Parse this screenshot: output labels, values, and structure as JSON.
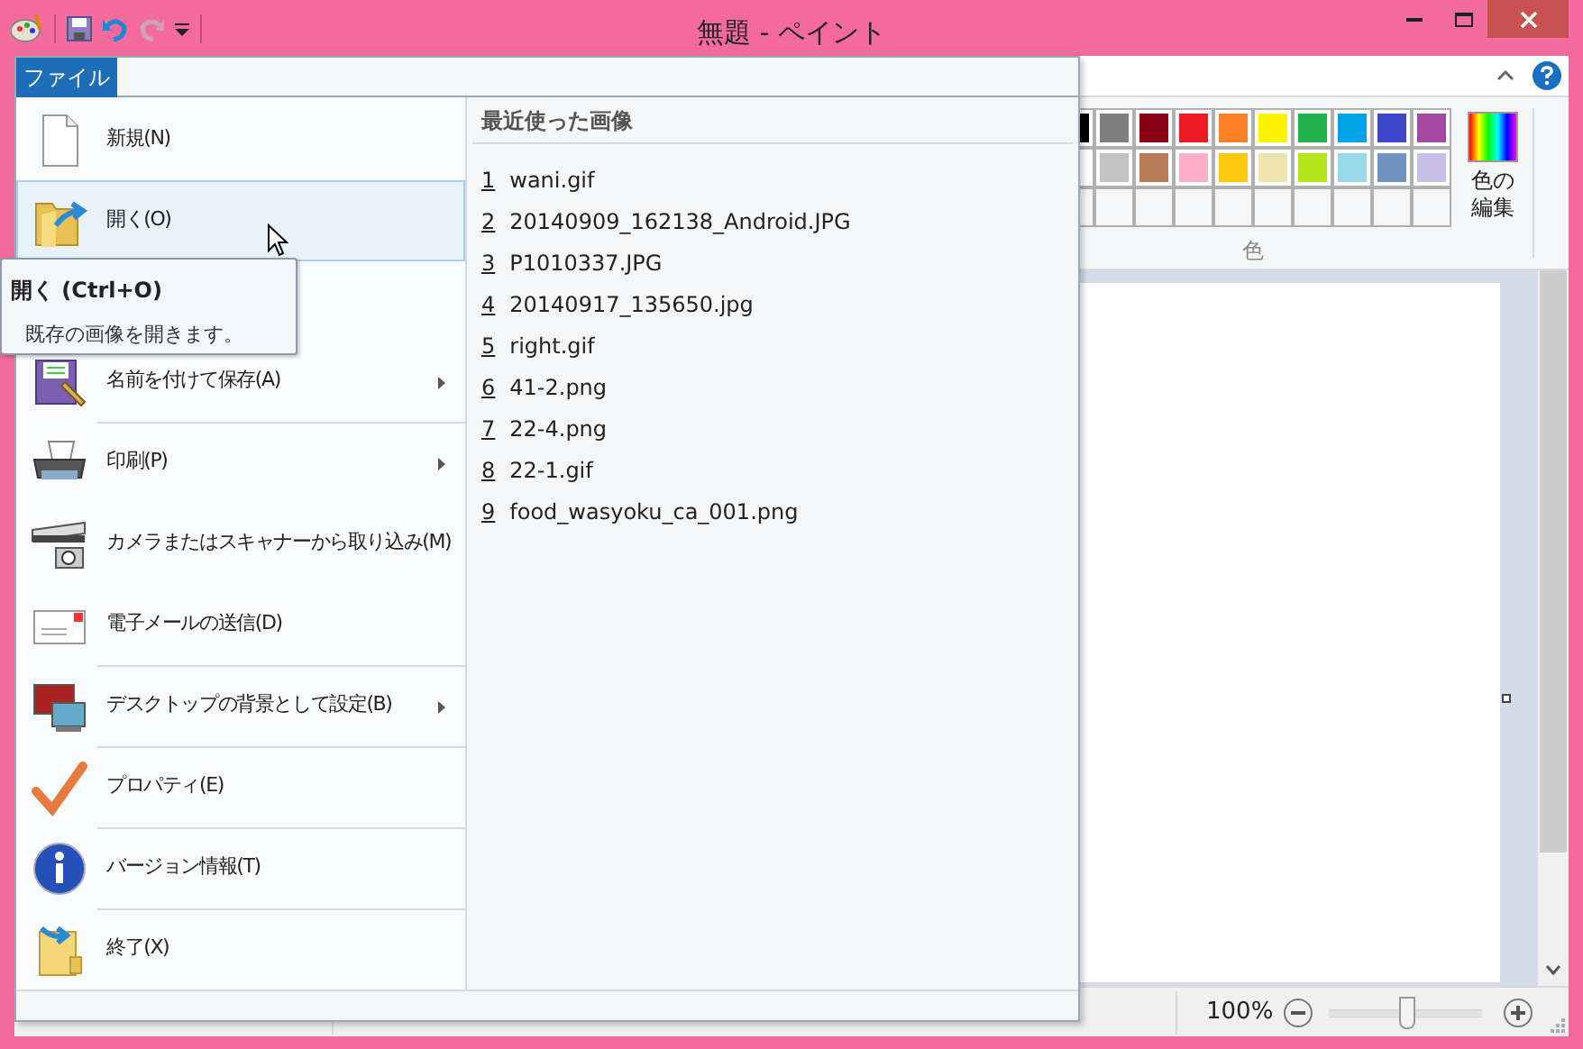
{
  "window": {
    "title": "無題 - ペイント"
  },
  "quick_access": [
    {
      "kind": "save",
      "disabled": false
    },
    {
      "kind": "undo",
      "disabled": false
    },
    {
      "kind": "redo",
      "disabled": true
    },
    {
      "kind": "customize",
      "disabled": false
    }
  ],
  "file_tab": {
    "label": "ファイル",
    "selected": true
  },
  "menu_items": [
    {
      "kind": "new",
      "label": "新規(N)",
      "selected": false,
      "submenu": false,
      "separator_above": false,
      "gap_above": false
    },
    {
      "kind": "open",
      "label": "開く(O)",
      "selected": true,
      "submenu": false,
      "separator_above": false,
      "gap_above": false
    },
    {
      "kind": "save_as",
      "label": "名前を付けて保存(A)",
      "selected": false,
      "submenu": true,
      "separator_above": false,
      "gap_above": true
    },
    {
      "kind": "print",
      "label": "印刷(P)",
      "selected": false,
      "submenu": true,
      "separator_above": true,
      "gap_above": false
    },
    {
      "kind": "scanner",
      "label": "カメラまたはスキャナーから取り込み(M)",
      "selected": false,
      "submenu": false,
      "separator_above": false,
      "gap_above": false
    },
    {
      "kind": "email",
      "label": "電子メールの送信(D)",
      "selected": false,
      "submenu": false,
      "separator_above": false,
      "gap_above": false
    },
    {
      "kind": "desktop",
      "label": "デスクトップの背景として設定(B)",
      "selected": false,
      "submenu": true,
      "separator_above": true,
      "gap_above": false
    },
    {
      "kind": "properties",
      "label": "プロパティ(E)",
      "selected": false,
      "submenu": false,
      "separator_above": true,
      "gap_above": false
    },
    {
      "kind": "about",
      "label": "バージョン情報(T)",
      "selected": false,
      "submenu": false,
      "separator_above": true,
      "gap_above": false
    },
    {
      "kind": "exit",
      "label": "終了(X)",
      "selected": false,
      "submenu": false,
      "separator_above": true,
      "gap_above": false
    }
  ],
  "tooltip": {
    "title": "開く (Ctrl+O)",
    "description": "既存の画像を開きます。"
  },
  "recent": {
    "heading": "最近使った画像",
    "files": [
      {
        "number": "1",
        "name": "wani.gif"
      },
      {
        "number": "2",
        "name": "20140909_162138_Android.JPG"
      },
      {
        "number": "3",
        "name": "P1010337.JPG"
      },
      {
        "number": "4",
        "name": "20140917_135650.jpg"
      },
      {
        "number": "5",
        "name": "right.gif"
      },
      {
        "number": "6",
        "name": "41-2.png"
      },
      {
        "number": "7",
        "name": "22-4.png"
      },
      {
        "number": "8",
        "name": "22-1.gif"
      },
      {
        "number": "9",
        "name": "food_wasyoku_ca_001.png"
      }
    ]
  },
  "palette": {
    "rows": [
      [
        {
          "kind": "swatch",
          "color": "#000000"
        },
        {
          "kind": "swatch",
          "color": "#7f7f7f"
        },
        {
          "kind": "swatch",
          "color": "#880015"
        },
        {
          "kind": "swatch",
          "color": "#ed1c24"
        },
        {
          "kind": "swatch",
          "color": "#ff7f27"
        },
        {
          "kind": "swatch",
          "color": "#fff200"
        },
        {
          "kind": "swatch",
          "color": "#22b14c"
        },
        {
          "kind": "swatch",
          "color": "#00a2e8"
        },
        {
          "kind": "swatch",
          "color": "#3f48cc"
        },
        {
          "kind": "swatch",
          "color": "#a349a4"
        }
      ],
      [
        {
          "kind": "swatch",
          "color": "#ffffff"
        },
        {
          "kind": "swatch",
          "color": "#c3c3c3"
        },
        {
          "kind": "swatch",
          "color": "#b97a57"
        },
        {
          "kind": "swatch",
          "color": "#ffaec9"
        },
        {
          "kind": "swatch",
          "color": "#ffc90e"
        },
        {
          "kind": "swatch",
          "color": "#efe4b0"
        },
        {
          "kind": "swatch",
          "color": "#b5e61d"
        },
        {
          "kind": "swatch",
          "color": "#99d9ea"
        },
        {
          "kind": "swatch",
          "color": "#7092be"
        },
        {
          "kind": "swatch",
          "color": "#c8bfe7"
        }
      ],
      [
        {
          "kind": "empty"
        },
        {
          "kind": "empty"
        },
        {
          "kind": "empty"
        },
        {
          "kind": "empty"
        },
        {
          "kind": "empty"
        },
        {
          "kind": "empty"
        },
        {
          "kind": "empty"
        },
        {
          "kind": "empty"
        },
        {
          "kind": "empty"
        },
        {
          "kind": "empty"
        }
      ]
    ],
    "edit_colors": "色の編集",
    "group_label": "色"
  },
  "status_bar": {
    "zoom": "100%",
    "zoom_slider": {
      "level": 0.5
    }
  }
}
